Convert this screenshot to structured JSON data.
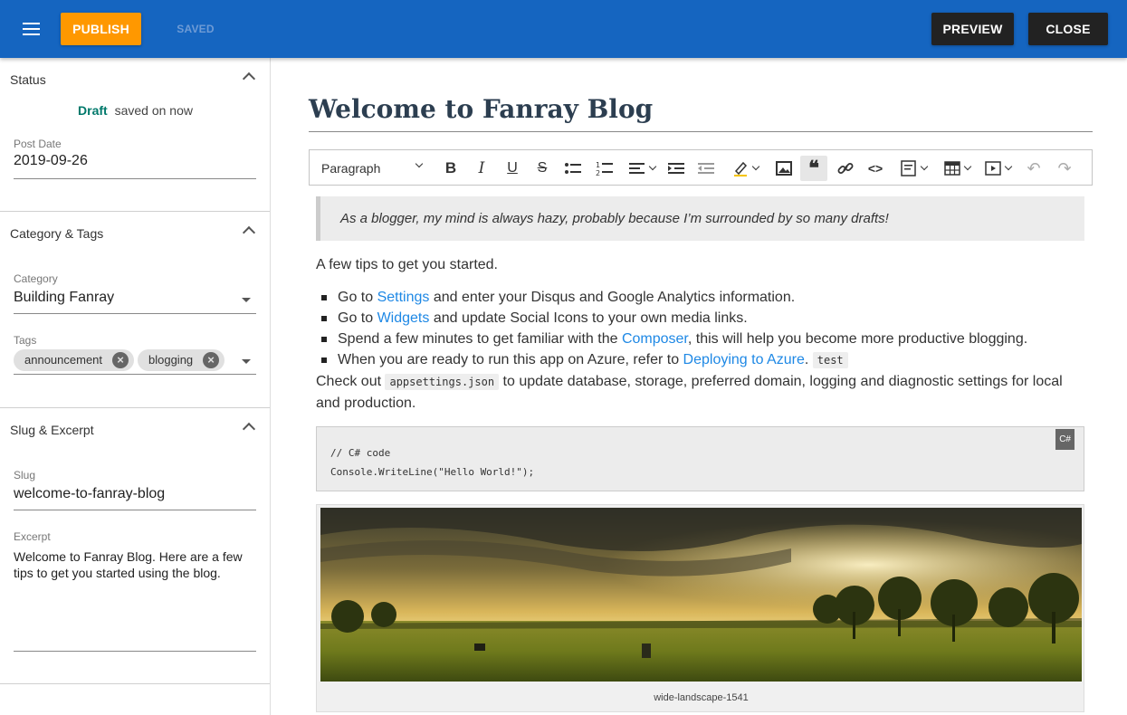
{
  "appbar": {
    "publish_label": "PUBLISH",
    "saved_label": "SAVED",
    "preview_label": "PREVIEW",
    "close_label": "CLOSE",
    "color": "#1565c0"
  },
  "sidebar": {
    "status": {
      "header": "Status",
      "draft_label": "Draft",
      "saved_text": "saved on now",
      "post_date_label": "Post Date",
      "post_date_value": "2019-09-26"
    },
    "category_tags": {
      "header": "Category & Tags",
      "category_label": "Category",
      "category_value": "Building Fanray",
      "tags_label": "Tags",
      "tags": [
        "announcement",
        "blogging"
      ]
    },
    "slug_excerpt": {
      "header": "Slug & Excerpt",
      "slug_label": "Slug",
      "slug_value": "welcome-to-fanray-blog",
      "excerpt_label": "Excerpt",
      "excerpt_value": "Welcome to Fanray Blog. Here are a few tips to get you started using the blog."
    }
  },
  "editor": {
    "title": "Welcome to Fanray Blog",
    "toolbar": {
      "heading_select": "Paragraph",
      "buttons": [
        "bold-icon",
        "italic-icon",
        "underline-icon",
        "strikethrough-icon",
        "bulleted-list-icon",
        "numbered-list-icon",
        "align-icon",
        "indent-icon",
        "outdent-icon",
        "highlight-icon",
        "image-icon",
        "quote-icon",
        "link-icon",
        "code-icon",
        "code-block-icon",
        "table-icon",
        "media-icon",
        "undo-icon",
        "redo-icon"
      ]
    },
    "blockquote": "As a blogger, my mind is always hazy, probably because I’m surrounded by so many drafts!",
    "intro": "A few tips to get you started.",
    "tips": [
      {
        "pre": "Go to ",
        "link": "Settings",
        "post": " and enter your Disqus and Google Analytics information."
      },
      {
        "pre": "Go to ",
        "link": "Widgets",
        "post": " and update Social Icons to your own media links."
      },
      {
        "pre": "Spend a few minutes to get familiar with the ",
        "link": "Composer",
        "post": ", this will help you become more productive blogging."
      },
      {
        "pre": "When you are ready to run this app on Azure, refer to ",
        "link": "Deploying to Azure",
        "post": ". ",
        "code": "test"
      }
    ],
    "checkout": {
      "pre": "Check out ",
      "code": "appsettings.json",
      "post": " to update database, storage, preferred domain, logging and diagnostic settings for local and production."
    },
    "codeblock": {
      "language": "C#",
      "line1": "// C# code",
      "line2": "Console.WriteLine(\"Hello World!\");"
    },
    "figure_caption": "wide-landscape-1541"
  }
}
